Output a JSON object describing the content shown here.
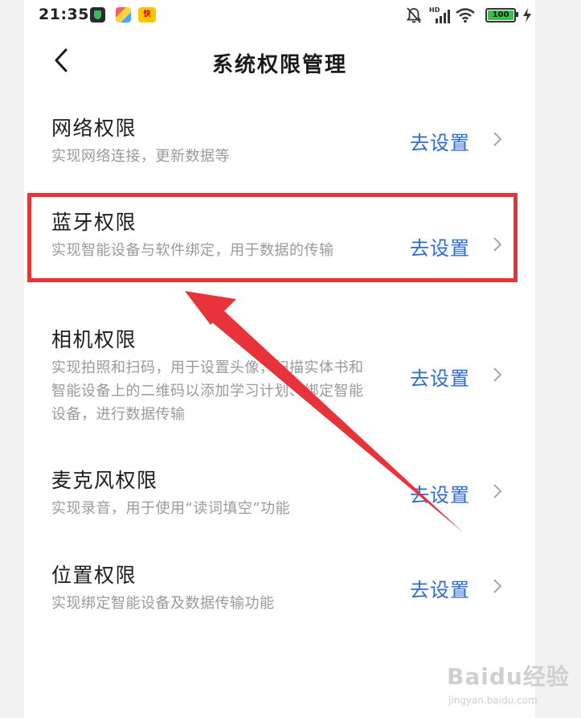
{
  "status_bar": {
    "time": "21:35",
    "network_label": "HD",
    "battery": "100",
    "icons": [
      "security-app-icon",
      "colorful-app-icon",
      "kuaishou-app-icon",
      "bell-muted-icon",
      "cell-signal-icon",
      "wifi-icon",
      "battery-icon",
      "charging-bolt-icon"
    ]
  },
  "header": {
    "title": "系统权限管理",
    "back_icon": "chevron-left-icon"
  },
  "permissions": [
    {
      "title": "网络权限",
      "description": "实现网络连接，更新数据等",
      "action": "去设置"
    },
    {
      "title": "蓝牙权限",
      "description": "实现智能设备与软件绑定，用于数据的传输",
      "action": "去设置"
    },
    {
      "title": "相机权限",
      "description": "实现拍照和扫码，用于设置头像，扫描实体书和智能设备上的二维码以添加学习计划、绑定智能设备，进行数据传输",
      "action": "去设置"
    },
    {
      "title": "麦克风权限",
      "description": "实现录音，用于使用“读词填空”功能",
      "action": "去设置"
    },
    {
      "title": "位置权限",
      "description": "实现绑定智能设备及数据传输功能",
      "action": "去设置"
    }
  ],
  "colors": {
    "accent": "#2c6ad6",
    "annotation": "#e8333a",
    "battery": "#3ac04c"
  },
  "watermark": {
    "main": "Baidu经验",
    "sub": "jingyan.baidu.com"
  }
}
